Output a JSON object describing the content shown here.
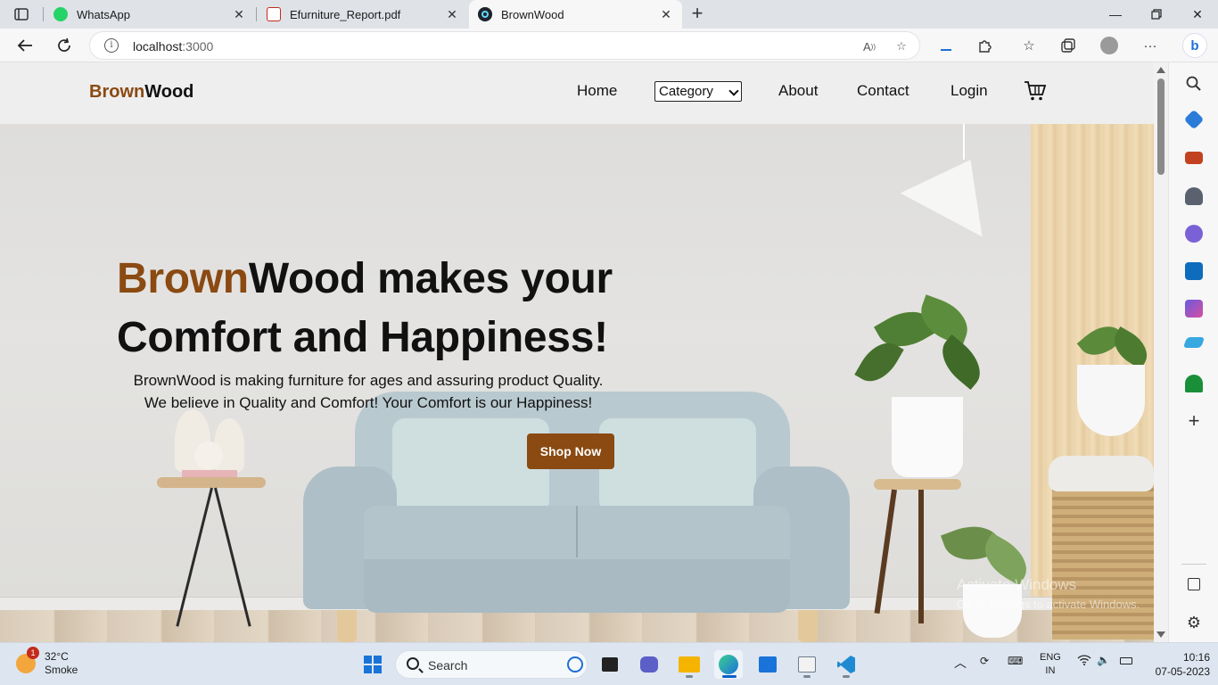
{
  "browser": {
    "tabs": [
      {
        "title": "WhatsApp",
        "icon": "whatsapp-icon",
        "active": false
      },
      {
        "title": "Efurniture_Report.pdf",
        "icon": "pdf-icon",
        "active": false
      },
      {
        "title": "BrownWood",
        "icon": "react-icon",
        "active": true
      }
    ],
    "address": {
      "host": "localhost",
      "port": ":3000"
    }
  },
  "site": {
    "brand_part1": "Brown",
    "brand_part2": "Wood",
    "nav": {
      "home": "Home",
      "category": "Category",
      "about": "About",
      "contact": "Contact",
      "login": "Login"
    },
    "hero": {
      "title_brand": "Brown",
      "title_rest": "Wood makes your",
      "title_line2": "Comfort and Happiness!",
      "sub_line1": "BrownWood is making furniture for ages and assuring product Quality.",
      "sub_line2": "We believe in Quality and Comfort! Your Comfort is our Happiness!",
      "cta": "Shop Now"
    },
    "watermark": {
      "line1": "Activate Windows",
      "line2": "Go to Settings to activate Windows."
    },
    "colors": {
      "brand": "#8a4a12"
    }
  },
  "taskbar": {
    "weather_temp": "32°C",
    "weather_desc": "Smoke",
    "weather_badge": "1",
    "search_label": "Search",
    "lang_top": "ENG",
    "lang_bottom": "IN",
    "time": "10:16",
    "date": "07-05-2023"
  }
}
